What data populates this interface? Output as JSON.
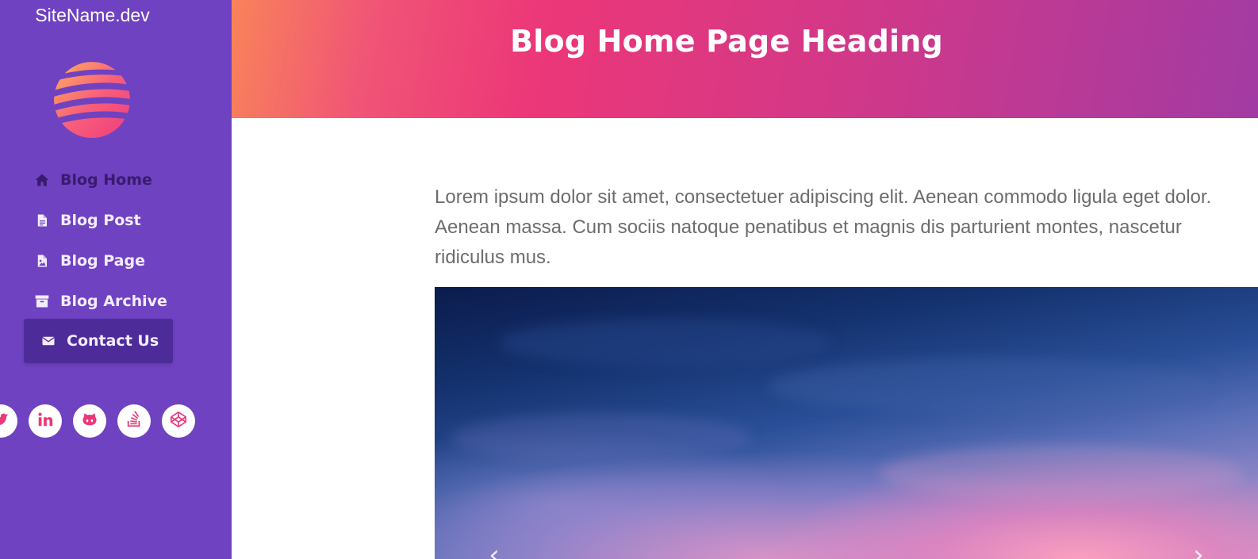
{
  "site": {
    "name": "SiteName.dev",
    "logo_icon": "striped-globe-logo"
  },
  "nav": {
    "items": [
      {
        "label": "Blog Home",
        "icon": "home-icon"
      },
      {
        "label": "Blog Post",
        "icon": "file-text-icon"
      },
      {
        "label": "Blog Page",
        "icon": "file-image-icon"
      },
      {
        "label": "Blog Archive",
        "icon": "archive-icon"
      },
      {
        "label": "Contact Us",
        "icon": "envelope-icon"
      }
    ]
  },
  "socials": [
    {
      "name": "twitter",
      "icon": "twitter-icon"
    },
    {
      "name": "linkedin",
      "icon": "linkedin-icon"
    },
    {
      "name": "github",
      "icon": "github-icon"
    },
    {
      "name": "stackoverflow",
      "icon": "stackoverflow-icon"
    },
    {
      "name": "codepen",
      "icon": "codepen-icon"
    }
  ],
  "header": {
    "title": "Blog Home Page Heading"
  },
  "main": {
    "intro": "Lorem ipsum dolor sit amet, consectetuer adipiscing elit. Aenean commodo ligula eget dolor. Aenean massa. Cum sociis natoque penatibus et magnis dis parturient montes, nascetur ridiculus mus.",
    "carousel": {
      "prev_icon": "chevron-left-icon",
      "next_icon": "chevron-right-icon",
      "prev_glyph": "‹",
      "next_glyph": "›"
    }
  },
  "colors": {
    "sidebar": "#6f42c1",
    "accent_pink": "#ec3778",
    "accent_orange": "#f9835a",
    "accent_purple": "#a23ba3",
    "nav_active_bg": "#4d2c9a"
  }
}
